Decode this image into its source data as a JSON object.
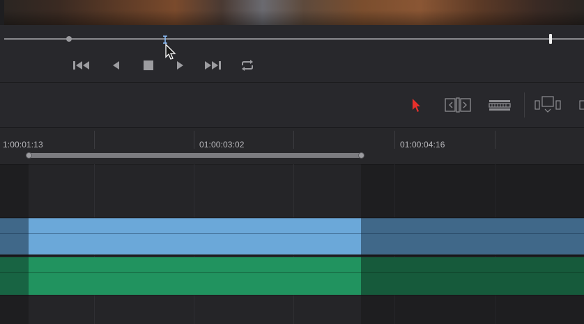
{
  "viewer": {
    "scrubber_playhead_icon": "playhead-marker"
  },
  "transport": {
    "buttons": [
      {
        "name": "jump-to-start",
        "icon": "skip-back-icon"
      },
      {
        "name": "reverse",
        "icon": "play-reverse-icon"
      },
      {
        "name": "stop",
        "icon": "stop-icon"
      },
      {
        "name": "play",
        "icon": "play-icon"
      },
      {
        "name": "jump-to-end",
        "icon": "skip-forward-icon"
      },
      {
        "name": "loop",
        "icon": "loop-icon"
      }
    ]
  },
  "toolbar": {
    "tools": [
      {
        "name": "selection-mode",
        "icon": "arrow-pointer-icon",
        "active": true,
        "color": "#e8302b"
      },
      {
        "name": "trim-edit-mode",
        "icon": "trim-icon"
      },
      {
        "name": "blade-edit-mode",
        "icon": "blade-icon"
      },
      {
        "name": "insert-clip",
        "icon": "insert-icon"
      }
    ]
  },
  "timeline": {
    "timecodes": [
      "1:00:01:13",
      "01:00:03:02",
      "01:00:04:16"
    ],
    "colors": {
      "video_clip": "#6ba8d9",
      "audio_clip": "#21935f"
    }
  }
}
